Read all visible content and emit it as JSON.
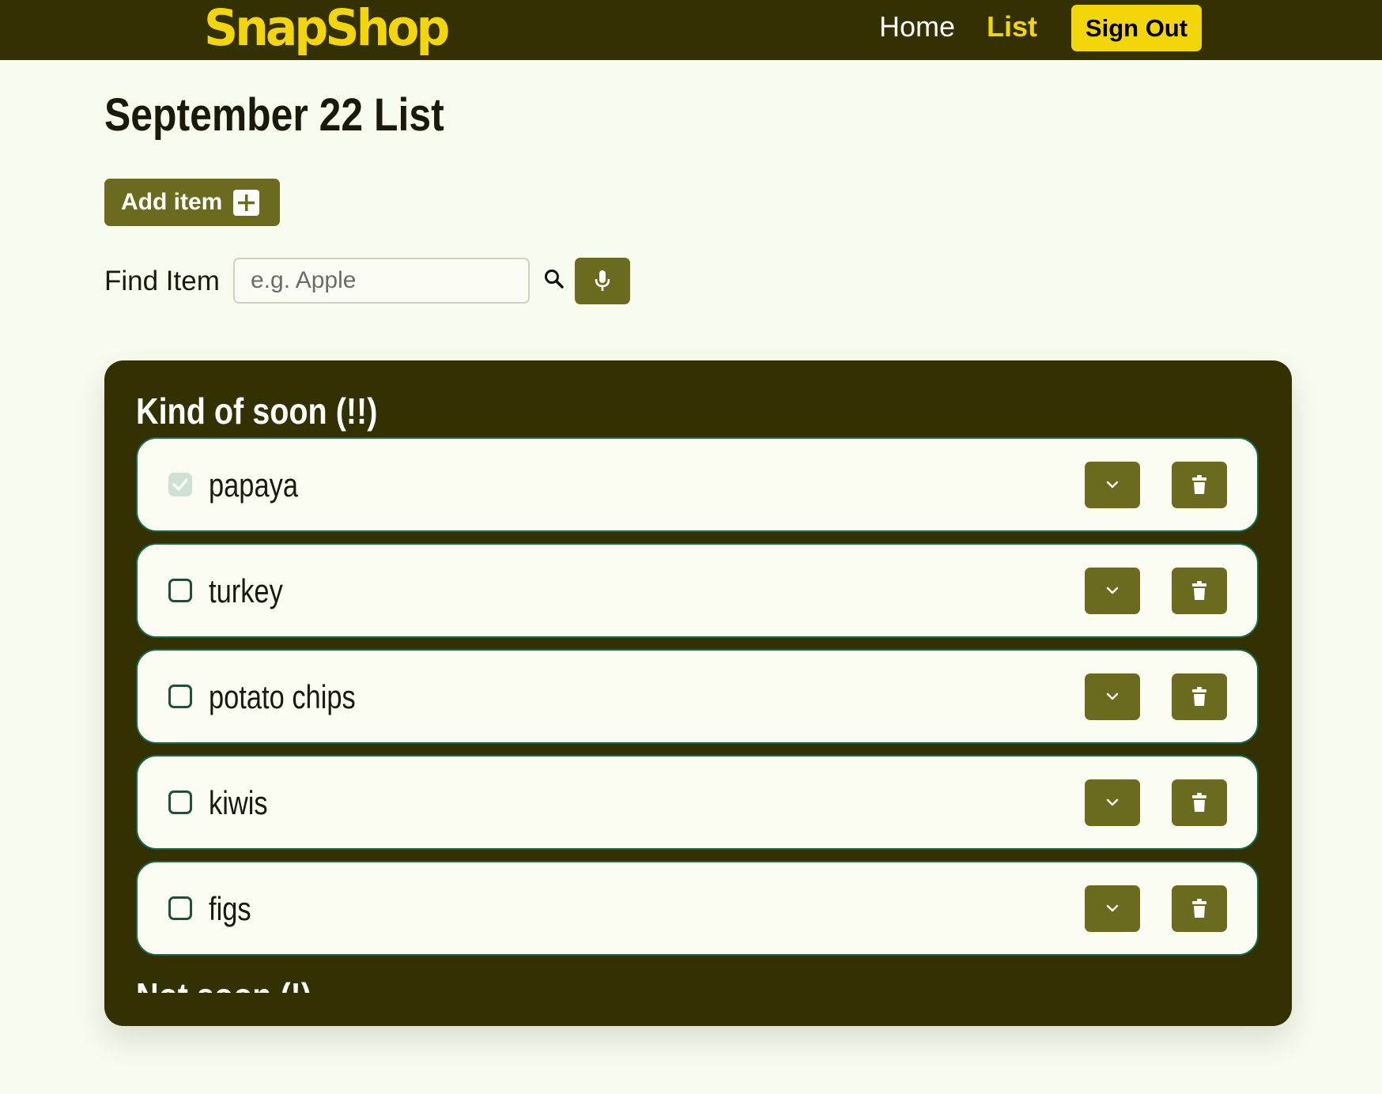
{
  "header": {
    "logo": "SnapShop",
    "nav": {
      "home": "Home",
      "list": "List",
      "sign_out": "Sign Out"
    }
  },
  "page": {
    "title": "September 22 List",
    "add_item_label": "Add item",
    "find_label": "Find Item",
    "find_placeholder": "e.g. Apple",
    "find_value": ""
  },
  "sections": [
    {
      "title": "Kind of soon (!!)",
      "items": [
        {
          "name": "papaya",
          "checked": true
        },
        {
          "name": "turkey",
          "checked": false
        },
        {
          "name": "potato chips",
          "checked": false
        },
        {
          "name": "kiwis",
          "checked": false
        },
        {
          "name": "figs",
          "checked": false
        }
      ]
    },
    {
      "title": "Not soon (!)",
      "items": []
    }
  ],
  "icons": {
    "add": "plus-square-icon",
    "search": "search-icon",
    "microphone": "microphone-icon",
    "expand": "chevron-down-icon",
    "delete": "trash-icon",
    "checked": "check-icon"
  },
  "colors": {
    "header_bg": "#333001",
    "brand_yellow": "#f3d60a",
    "button_olive": "#6a6b1f",
    "page_bg": "#f8fcee",
    "panel_bg": "#333001",
    "item_bg": "#fbfdf3",
    "item_border": "#146b4a"
  }
}
